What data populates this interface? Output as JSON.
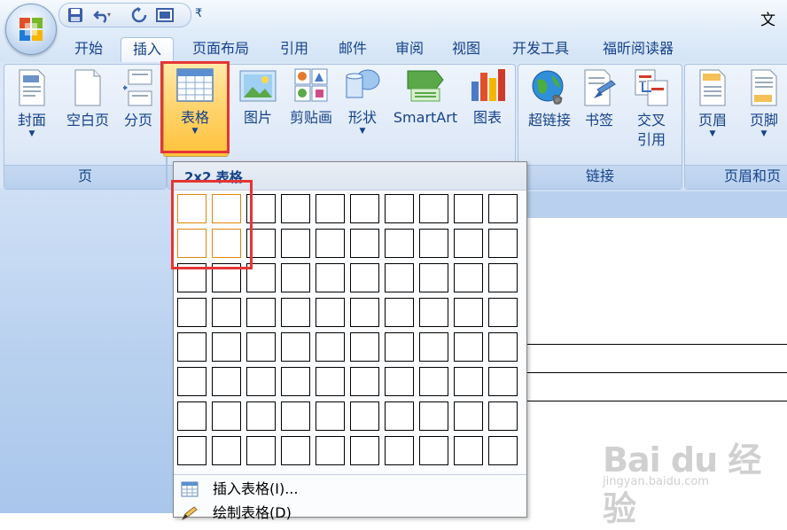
{
  "window": {
    "title": "文档"
  },
  "tabs": [
    "开始",
    "插入",
    "页面布局",
    "引用",
    "邮件",
    "审阅",
    "视图",
    "开发工具",
    "福昕阅读器"
  ],
  "active_tab": "插入",
  "ribbon": {
    "groups": {
      "pages": {
        "label": "页",
        "buttons": [
          "封面",
          "空白页",
          "分页"
        ]
      },
      "illustrations": {
        "buttons": [
          "表格",
          "图片",
          "剪贴画",
          "形状",
          "SmartArt",
          "图表"
        ]
      },
      "links": {
        "label": "链接",
        "buttons": [
          "超链接",
          "书签",
          "交叉",
          "引用"
        ]
      },
      "header_footer": {
        "label": "页眉和页",
        "buttons": [
          "页眉",
          "页脚"
        ]
      }
    }
  },
  "table_dropdown": {
    "header": "2x2 表格",
    "grid": {
      "columns": 10,
      "rows": 8,
      "selected_columns": 2,
      "selected_rows": 2
    },
    "items": [
      "插入表格(I)...",
      "绘制表格(D)"
    ]
  },
  "colors": {
    "highlight": "#e53535",
    "selected_cell": "#e2850c",
    "ribbon_text": "#15428b"
  },
  "watermark": {
    "logo": "Bai du 经验",
    "url": "jingyan.baidu.com"
  }
}
